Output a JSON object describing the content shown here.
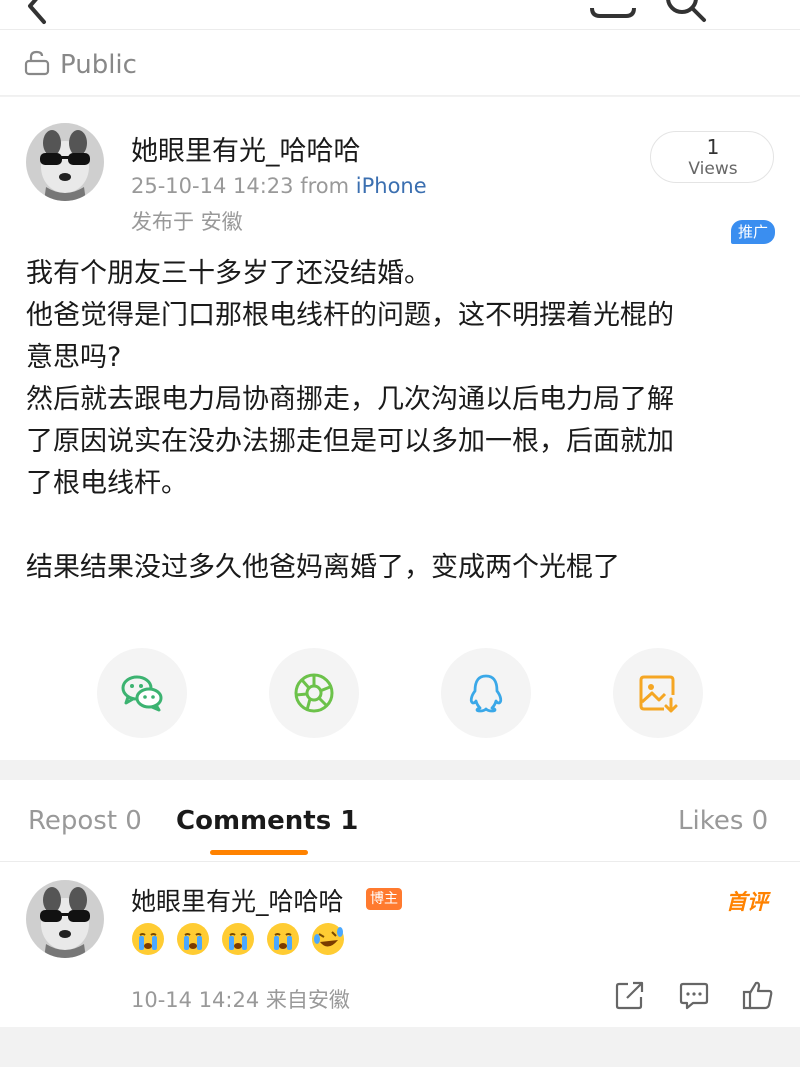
{
  "visibility": {
    "label": "Public"
  },
  "post": {
    "author": "她眼里有光_哈哈哈",
    "time": "25-10-14 14:23",
    "from_prefix": "from",
    "from_source": "iPhone",
    "location": "发布于 安徽",
    "views": {
      "count": "1",
      "label": "Views"
    },
    "promo_tag": "推广",
    "content_lines": [
      "我有个朋友三十多岁了还没结婚。",
      "他爸觉得是门口那根电线杆的问题，这不明摆着光棍的",
      "意思吗?",
      "然后就去跟电力局协商挪走，几次沟通以后电力局了解",
      "了原因说实在没办法挪走但是可以多加一根，后面就加",
      "了根电线杆。",
      "结果结果没过多久他爸妈离婚了，变成两个光棍了"
    ],
    "share_icons": [
      "wechat-icon",
      "moments-icon",
      "qq-icon",
      "save-image-icon"
    ]
  },
  "tabs": {
    "repost": "Repost 0",
    "comments": "Comments 1",
    "likes": "Likes 0"
  },
  "comment": {
    "author": "她眼里有光_哈哈哈",
    "author_badge": "博主",
    "first_badge": "首评",
    "emojis": [
      "crying-face",
      "crying-face",
      "crying-face",
      "crying-face",
      "laughing-face"
    ],
    "time": "10-14 14:24 来自安徽"
  },
  "colors": {
    "accent": "#ff8200",
    "link": "#3b6fb0",
    "wechat": "#3cb371",
    "moments": "#6cc24a",
    "qq": "#3aa8e8",
    "save": "#f5a623"
  }
}
